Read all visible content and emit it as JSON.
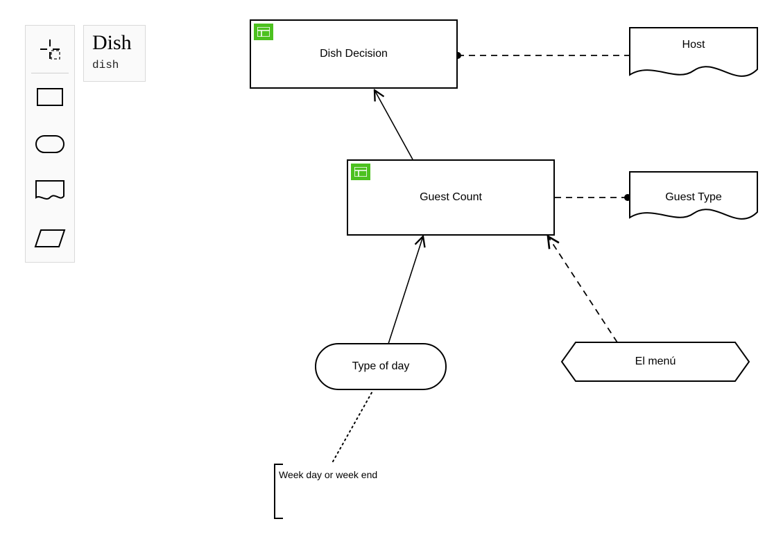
{
  "palette": {
    "tools": [
      "lasso",
      "rectangle",
      "rounded",
      "document",
      "parallelogram"
    ]
  },
  "dish_card": {
    "title": "Dish",
    "subtitle": "dish"
  },
  "nodes": {
    "dish_decision": {
      "label": "Dish Decision"
    },
    "guest_count": {
      "label": "Guest Count"
    },
    "type_of_day": {
      "label": "Type of day"
    },
    "host": {
      "label": "Host"
    },
    "guest_type": {
      "label": "Guest Type"
    },
    "el_menu": {
      "label": "El menú"
    }
  },
  "annotation": {
    "text": "Week day or week end"
  },
  "connectors": [
    {
      "from": "guest_count",
      "to": "dish_decision",
      "style": "solid",
      "arrow": "target"
    },
    {
      "from": "type_of_day",
      "to": "guest_count",
      "style": "solid",
      "arrow": "target"
    },
    {
      "from": "dish_decision",
      "to": "host",
      "style": "dashed",
      "arrow": "dot-source"
    },
    {
      "from": "guest_count",
      "to": "guest_type",
      "style": "dashed",
      "arrow": "dot-target"
    },
    {
      "from": "el_menu",
      "to": "guest_count",
      "style": "dashed",
      "arrow": "target"
    },
    {
      "from": "annotation",
      "to": "type_of_day",
      "style": "dotted",
      "arrow": "none"
    }
  ]
}
